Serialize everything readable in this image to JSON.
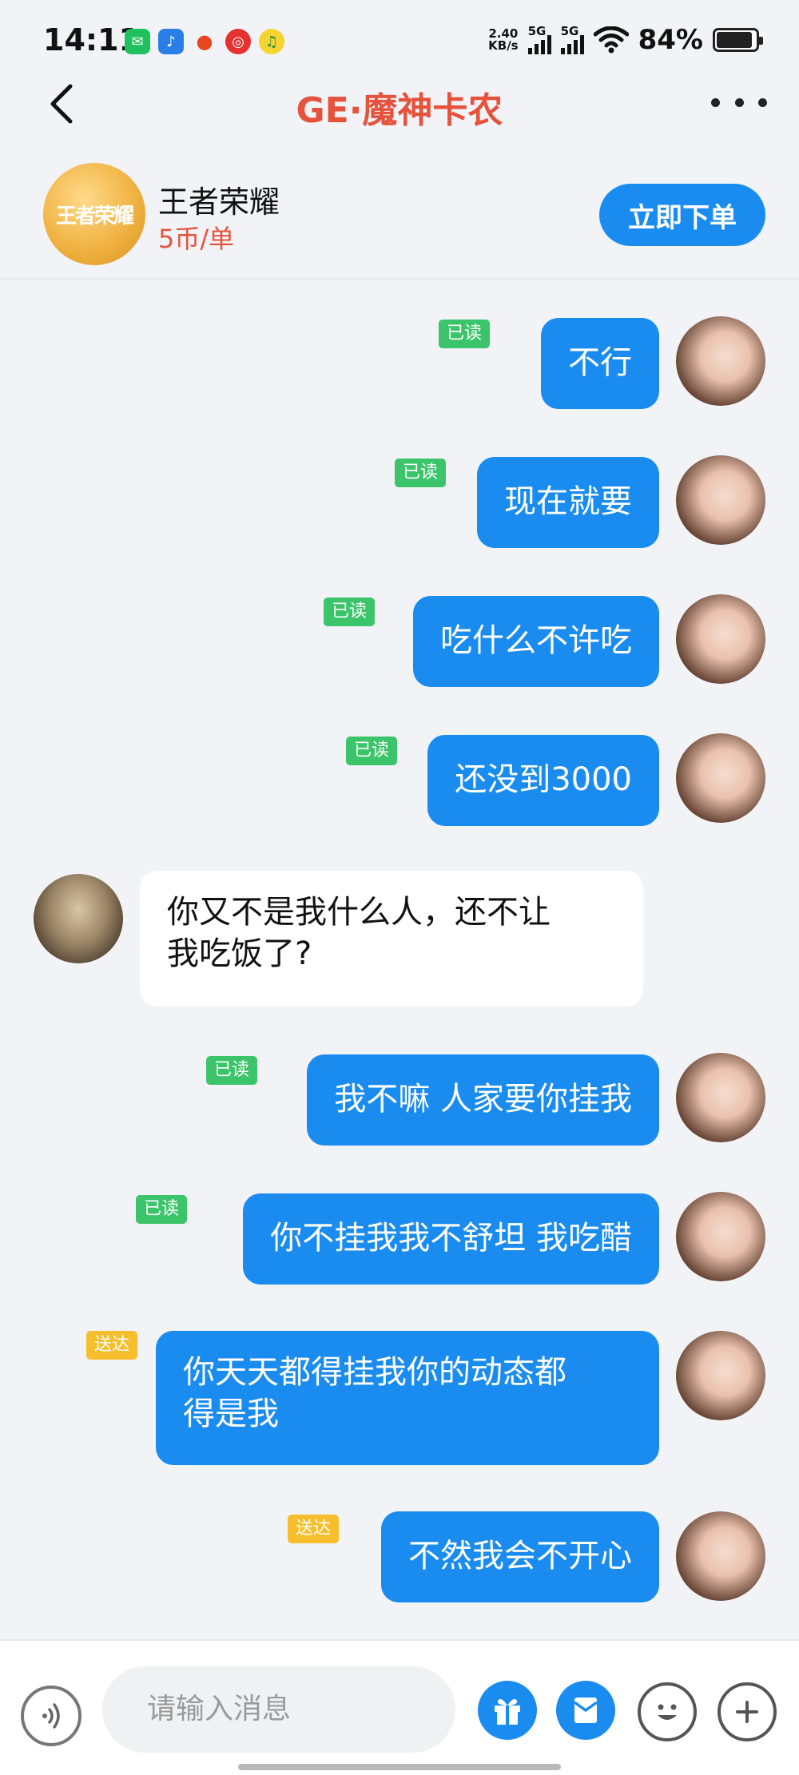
{
  "status_bar": {
    "time": "14:11",
    "app_icons": [
      "wechat-icon",
      "music-app-icon",
      "weibo-icon",
      "netease-music-icon",
      "qq-music-icon"
    ],
    "net_speed_value": "2.40",
    "net_speed_unit": "KB/s",
    "signal_1_label": "5G",
    "signal_2_label": "5G",
    "battery_percent": "84%",
    "battery_level": 0.84
  },
  "header": {
    "title": "GE·魔神卡农"
  },
  "product": {
    "logo_text": "王者荣耀",
    "game_name": "王者荣耀",
    "price": "5币/单",
    "order_button": "立即下单"
  },
  "messages": [
    {
      "from": "me",
      "text": "不行",
      "status": "已读"
    },
    {
      "from": "me",
      "text": "现在就要",
      "status": "已读"
    },
    {
      "from": "me",
      "text": "吃什么不许吃",
      "status": "已读"
    },
    {
      "from": "me",
      "text": "还没到3000",
      "status": "已读"
    },
    {
      "from": "other",
      "text": "你又不是我什么人，还不让\n我吃饭了?"
    },
    {
      "from": "me",
      "text": "我不嘛 人家要你挂我",
      "status": "已读"
    },
    {
      "from": "me",
      "text": "你不挂我我不舒坦 我吃醋",
      "status": "已读"
    },
    {
      "from": "me",
      "text": "你天天都得挂我你的动态都\n得是我",
      "status": "送达"
    },
    {
      "from": "me",
      "text": "不然我会不开心",
      "status": "送达"
    }
  ],
  "input": {
    "placeholder": "请输入消息"
  },
  "colors": {
    "accent_blue": "#1a8cf0",
    "title_red": "#e5533d",
    "read_badge": "#3cc46b",
    "sent_badge": "#f6be2c"
  }
}
